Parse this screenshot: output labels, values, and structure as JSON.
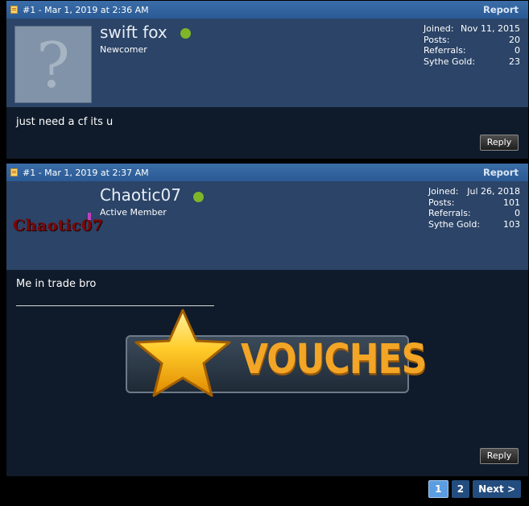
{
  "posts": [
    {
      "meta": "#1 - Mar 1, 2019 at 2:36 AM",
      "report_label": "Report",
      "username": "swift fox",
      "user_title": "Newcomer",
      "stats": [
        {
          "label": "Joined:",
          "value": "Nov 11, 2015"
        },
        {
          "label": "Posts:",
          "value": "20"
        },
        {
          "label": "Referrals:",
          "value": "0"
        },
        {
          "label": "Sythe Gold:",
          "value": "23"
        }
      ],
      "message": "just need a cf its u",
      "reply_label": "Reply"
    },
    {
      "meta": "#1 - Mar 1, 2019 at 2:37 AM",
      "report_label": "Report",
      "username": "Chaotic07",
      "avatar_text": "Chaotic07",
      "user_title": "Active Member",
      "stats": [
        {
          "label": "Joined:",
          "value": "Jul 26, 2018"
        },
        {
          "label": "Posts:",
          "value": "101"
        },
        {
          "label": "Referrals:",
          "value": "0"
        },
        {
          "label": "Sythe Gold:",
          "value": "103"
        }
      ],
      "message": "Me in trade bro",
      "signature_banner": "VOUCHES",
      "reply_label": "Reply"
    }
  ],
  "pagination": {
    "pages": [
      "1",
      "2"
    ],
    "current": "1",
    "next_label": "Next >"
  },
  "colors": {
    "header_bar": "#2b5a94",
    "user_panel": "#2b4467",
    "post_body": "#0f1b2a",
    "online": "#7fb528",
    "vouches_orange": "#f3a526"
  }
}
